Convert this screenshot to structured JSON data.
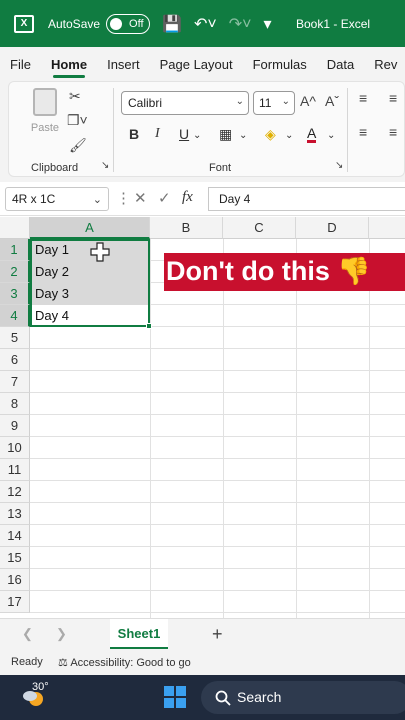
{
  "titlebar": {
    "app_icon_label": "X",
    "autosave_label": "AutoSave",
    "toggle_label": "Off",
    "book_title": "Book1  -  Excel"
  },
  "tabs": [
    "File",
    "Home",
    "Insert",
    "Page Layout",
    "Formulas",
    "Data",
    "Rev"
  ],
  "ribbon": {
    "paste_label": "Paste",
    "clipboard_label": "Clipboard",
    "font_name": "Calibri",
    "font_size": "11",
    "font_label": "Font",
    "bold": "B",
    "italic": "I",
    "underline": "U",
    "grow_font": "A^",
    "shrink_font": "Aˇ",
    "font_color_glyph": "A"
  },
  "formula_bar": {
    "name_box": "4R x 1C",
    "fx_label": "fx",
    "content": "Day 4"
  },
  "grid": {
    "columns": [
      "A",
      "B",
      "C",
      "D"
    ],
    "rows": [
      "1",
      "2",
      "3",
      "4",
      "5",
      "6",
      "7",
      "8",
      "9",
      "10",
      "11",
      "12",
      "13",
      "14",
      "15",
      "16",
      "17"
    ],
    "cells_a": [
      "Day 1",
      "Day 2",
      "Day 3",
      "Day 4"
    ]
  },
  "banner": {
    "text": "Don't do this 👎"
  },
  "sheets": {
    "active": "Sheet1",
    "add": "+"
  },
  "status": {
    "ready": "Ready",
    "accessibility": "Accessibility: Good to go"
  },
  "taskbar": {
    "temperature": "30°",
    "search_label": "Search"
  },
  "colors": {
    "excel_green": "#107c41",
    "banner_red": "#c8102e",
    "taskbar": "#1f2a3d"
  }
}
